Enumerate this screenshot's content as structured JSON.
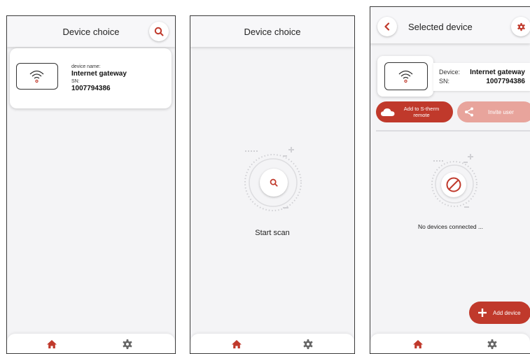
{
  "colors": {
    "accent": "#c0392b",
    "accent_light": "#e8a49c",
    "nav_inactive": "#666666",
    "bg": "#f4f4f6"
  },
  "screen1": {
    "title": "Device choice",
    "search_icon": "search-icon",
    "device": {
      "name_label": "device name:",
      "name": "Internet gateway",
      "sn_label": "SN:",
      "sn": "1007794386",
      "icon": "wifi-icon"
    },
    "nav": {
      "home_icon": "home-icon",
      "settings_icon": "gear-icon"
    }
  },
  "screen2": {
    "title": "Device choice",
    "scan_label": "Start scan",
    "scan_icon": "search-icon",
    "nav": {
      "home_icon": "home-icon",
      "settings_icon": "gear-icon"
    }
  },
  "screen3": {
    "title": "Selected device",
    "back_icon": "chevron-left-icon",
    "settings_icon": "gear-icon",
    "device": {
      "device_label": "Device:",
      "name": "Internet gateway",
      "sn_label": "SN:",
      "sn": "1007794386",
      "icon": "wifi-icon"
    },
    "add_remote_label": "Add to S-therm remote",
    "invite_label": "Invite user",
    "empty_label": "No devices connected ...",
    "add_device_label": "Add device",
    "nav": {
      "home_icon": "home-icon",
      "settings_icon": "gear-icon"
    }
  }
}
